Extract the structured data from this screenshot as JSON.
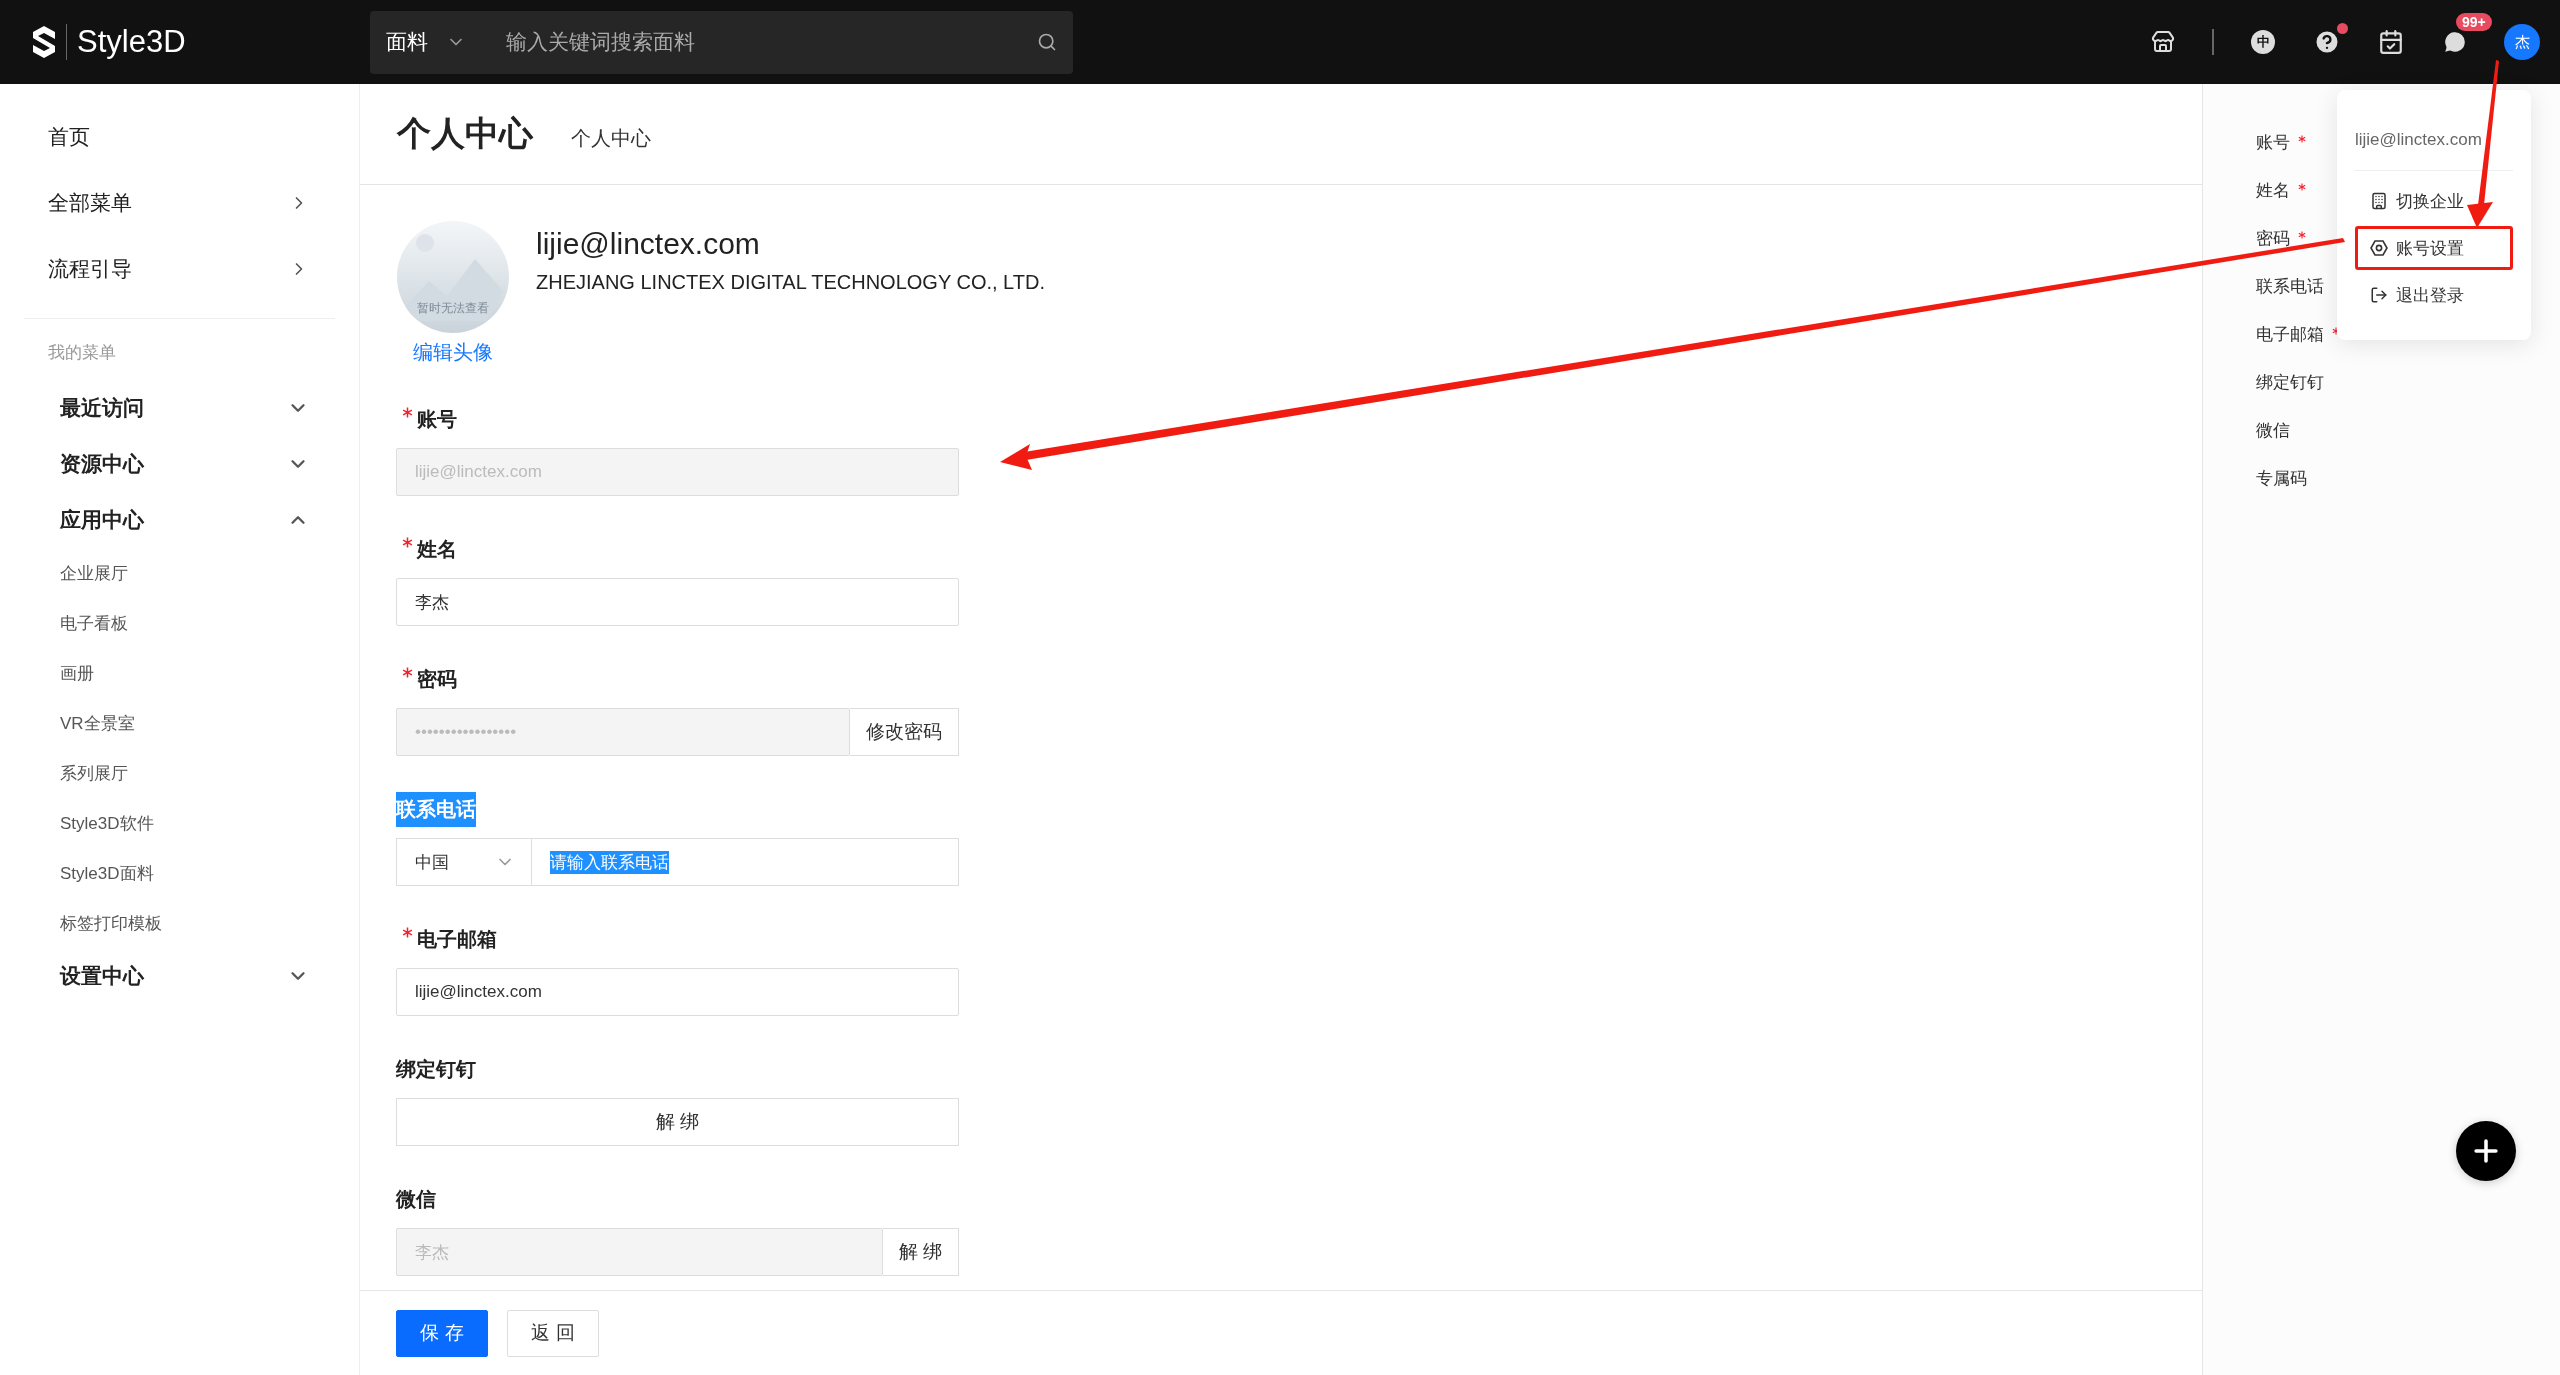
{
  "topbar": {
    "logo": "Style3D",
    "search": {
      "category": "面料",
      "placeholder": "输入关键词搜索面料"
    },
    "language": "中",
    "help_dot": true,
    "messages_badge": "99+",
    "avatar": "杰"
  },
  "user_menu": {
    "email": "lijie@linctex.com",
    "items": [
      {
        "label": "切换企业",
        "kind": "building",
        "highlighted": false
      },
      {
        "label": "账号设置",
        "kind": "gear",
        "highlighted": true
      },
      {
        "label": "退出登录",
        "kind": "logout",
        "highlighted": false
      }
    ]
  },
  "sidebar": {
    "items": [
      {
        "label": "首页",
        "has_arrow": false
      },
      {
        "label": "全部菜单",
        "has_arrow": true
      },
      {
        "label": "流程引导",
        "has_arrow": true
      }
    ],
    "section": "我的菜单",
    "groups": [
      {
        "label": "最近访问",
        "expanded": false
      },
      {
        "label": "资源中心",
        "expanded": false
      },
      {
        "label": "应用中心",
        "expanded": true,
        "children": [
          "企业展厅",
          "电子看板",
          "画册",
          "VR全景室",
          "系列展厅",
          "Style3D软件",
          "Style3D面料",
          "标签打印模板"
        ]
      },
      {
        "label": "设置中心",
        "expanded": false
      }
    ]
  },
  "page": {
    "title": "个人中心",
    "breadcrumb": "个人中心"
  },
  "profile": {
    "email": "lijie@linctex.com",
    "company": "ZHEJIANG LINCTEX DIGITAL TECHNOLOGY CO., LTD.",
    "avatar_caption": "暂时无法查看",
    "edit_link": "编辑头像"
  },
  "form": {
    "fields": [
      {
        "kind": "text",
        "label": "账号",
        "required": true,
        "value": "lijie@linctex.com",
        "disabled": true
      },
      {
        "kind": "text",
        "label": "姓名",
        "required": true,
        "value": "李杰",
        "disabled": false
      },
      {
        "kind": "text",
        "label": "密码",
        "required": true,
        "value": "•••••••••••••••••",
        "disabled": true,
        "button": "修改密码"
      },
      {
        "kind": "phone",
        "label": "联系电话",
        "required": false,
        "text_selected": true,
        "country": "中国",
        "placeholder": "请输入联系电话"
      },
      {
        "kind": "text",
        "label": "电子邮箱",
        "required": true,
        "value": "lijie@linctex.com",
        "disabled": false
      },
      {
        "kind": "action",
        "label": "绑定钉钉",
        "required": false,
        "button": "解 绑"
      },
      {
        "kind": "text",
        "label": "微信",
        "required": false,
        "value": "李杰",
        "disabled": true,
        "button": "解 绑"
      }
    ]
  },
  "actions": [
    {
      "label": "保 存",
      "primary": true
    },
    {
      "label": "返 回",
      "primary": false
    }
  ],
  "anchor_nav": [
    {
      "label": "账号",
      "required": true
    },
    {
      "label": "姓名",
      "required": true
    },
    {
      "label": "密码",
      "required": true
    },
    {
      "label": "联系电话",
      "required": false
    },
    {
      "label": "电子邮箱",
      "required": true
    },
    {
      "label": "绑定钉钉",
      "required": false
    },
    {
      "label": "微信",
      "required": false
    },
    {
      "label": "专属码",
      "required": false
    }
  ]
}
